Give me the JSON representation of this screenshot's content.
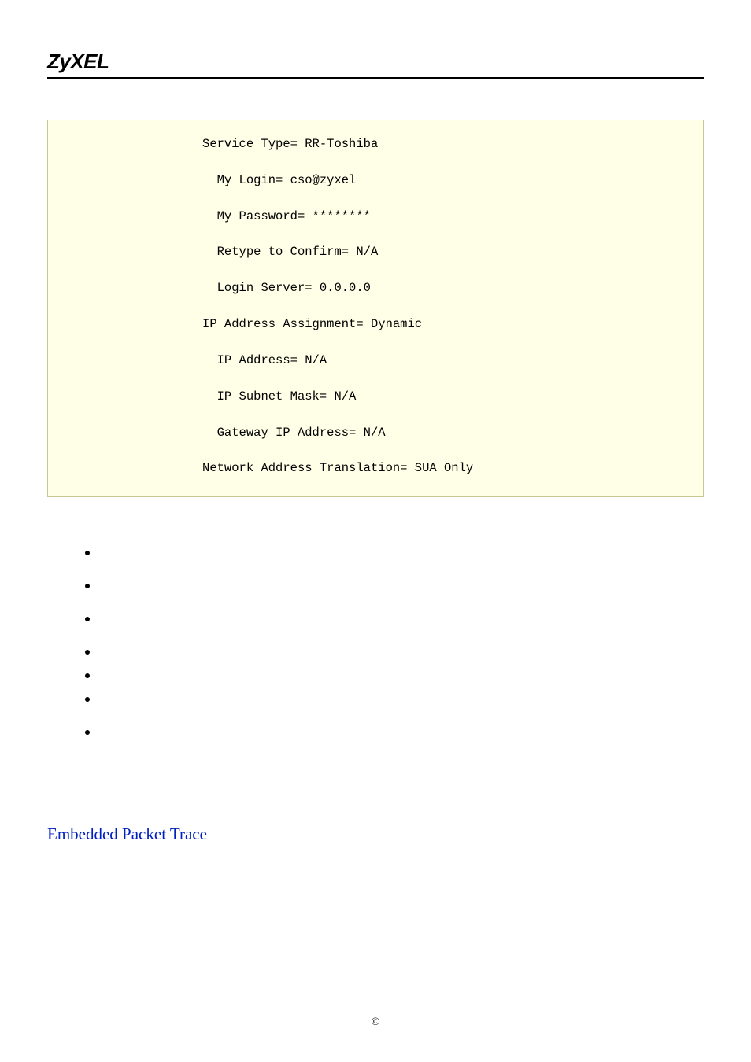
{
  "header": {
    "logo": "ZyXEL"
  },
  "config": {
    "lines": [
      {
        "indent": 20,
        "text": "Service Type= RR-Toshiba"
      },
      {
        "blank": true
      },
      {
        "indent": 22,
        "text": "My Login= cso@zyxel"
      },
      {
        "blank": true
      },
      {
        "indent": 22,
        "text": "My Password= ********"
      },
      {
        "blank": true
      },
      {
        "indent": 22,
        "text": "Retype to Confirm= N/A"
      },
      {
        "blank": true
      },
      {
        "indent": 22,
        "text": "Login Server= 0.0.0.0"
      },
      {
        "blank": true
      },
      {
        "indent": 20,
        "text": "IP Address Assignment= Dynamic"
      },
      {
        "blank": true
      },
      {
        "indent": 22,
        "text": "IP Address= N/A"
      },
      {
        "blank": true
      },
      {
        "indent": 22,
        "text": "IP Subnet Mask= N/A"
      },
      {
        "blank": true
      },
      {
        "indent": 22,
        "text": "Gateway IP Address= N/A"
      },
      {
        "blank": true
      },
      {
        "indent": 20,
        "text": "Network Address Translation= SUA Only"
      }
    ]
  },
  "bullets": [
    {
      "tight": false
    },
    {
      "tight": false
    },
    {
      "tight": false
    },
    {
      "tight": true
    },
    {
      "tight": true
    },
    {
      "tight": false
    },
    {
      "tight": false
    }
  ],
  "section": {
    "title": "Embedded Packet Trace"
  },
  "footer": {
    "copyright": "©"
  }
}
